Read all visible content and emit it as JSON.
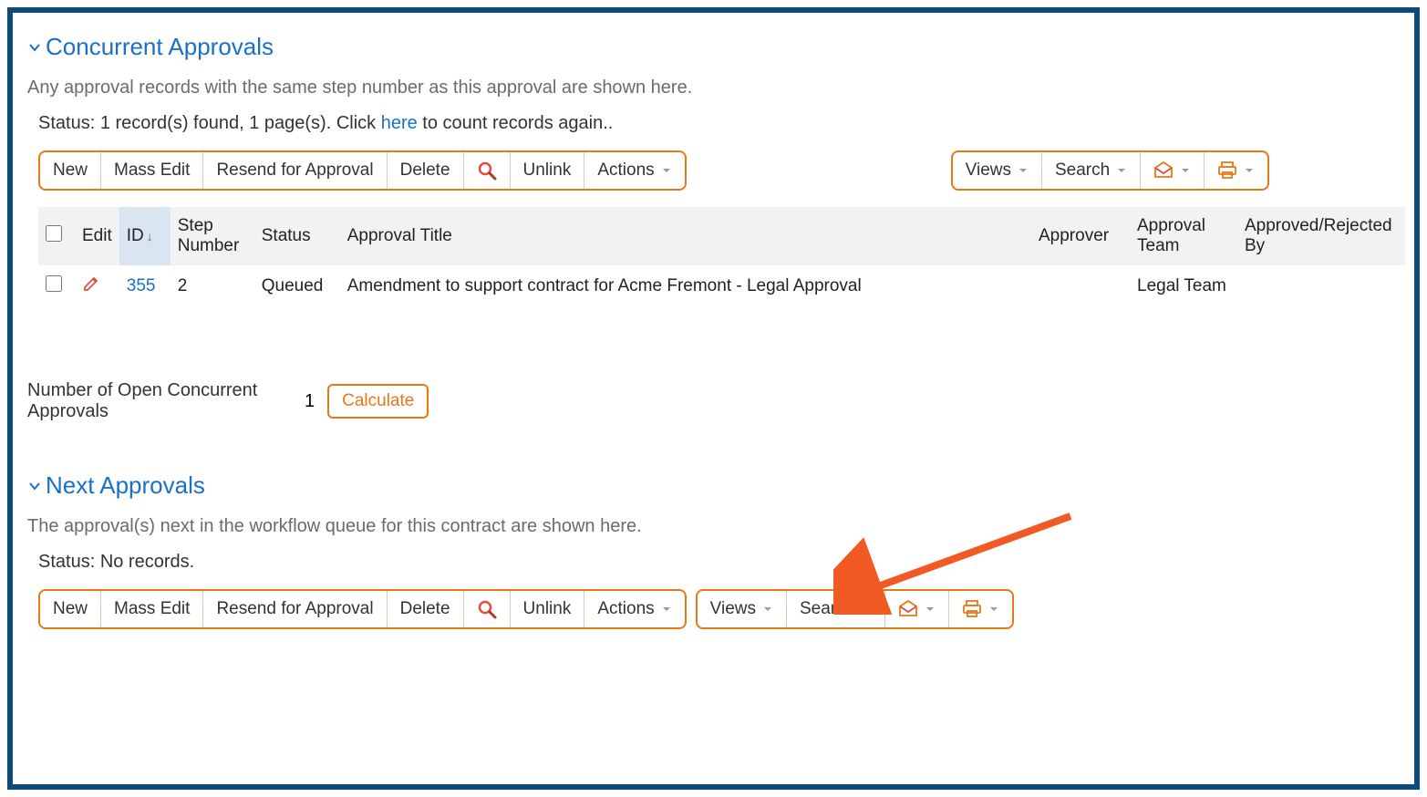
{
  "sections": {
    "concurrent": {
      "title": "Concurrent Approvals",
      "description": "Any approval records with the same step number as this approval are shown here.",
      "status_prefix": "Status: 1 record(s) found, 1 page(s). Click ",
      "status_link": "here",
      "status_suffix": " to count records again.."
    },
    "next": {
      "title": "Next Approvals",
      "description": "The approval(s) next in the workflow queue for this contract are shown here.",
      "status": "Status: No records."
    }
  },
  "toolbar": {
    "new": "New",
    "mass_edit": "Mass Edit",
    "resend": "Resend for Approval",
    "delete": "Delete",
    "unlink": "Unlink",
    "actions": "Actions",
    "views": "Views",
    "search": "Search"
  },
  "table": {
    "headers": {
      "edit": "Edit",
      "id": "ID",
      "step": "Step Number",
      "status": "Status",
      "title": "Approval Title",
      "approver": "Approver",
      "team": "Approval Team",
      "by": "Approved/Rejected By"
    },
    "rows": [
      {
        "id": "355",
        "step": "2",
        "status": "Queued",
        "title": "Amendment to support contract for Acme Fremont - Legal Approval",
        "approver": "",
        "team": "Legal Team",
        "by": ""
      }
    ]
  },
  "calc": {
    "label": "Number of Open Concurrent Approvals",
    "value": "1",
    "button": "Calculate"
  }
}
